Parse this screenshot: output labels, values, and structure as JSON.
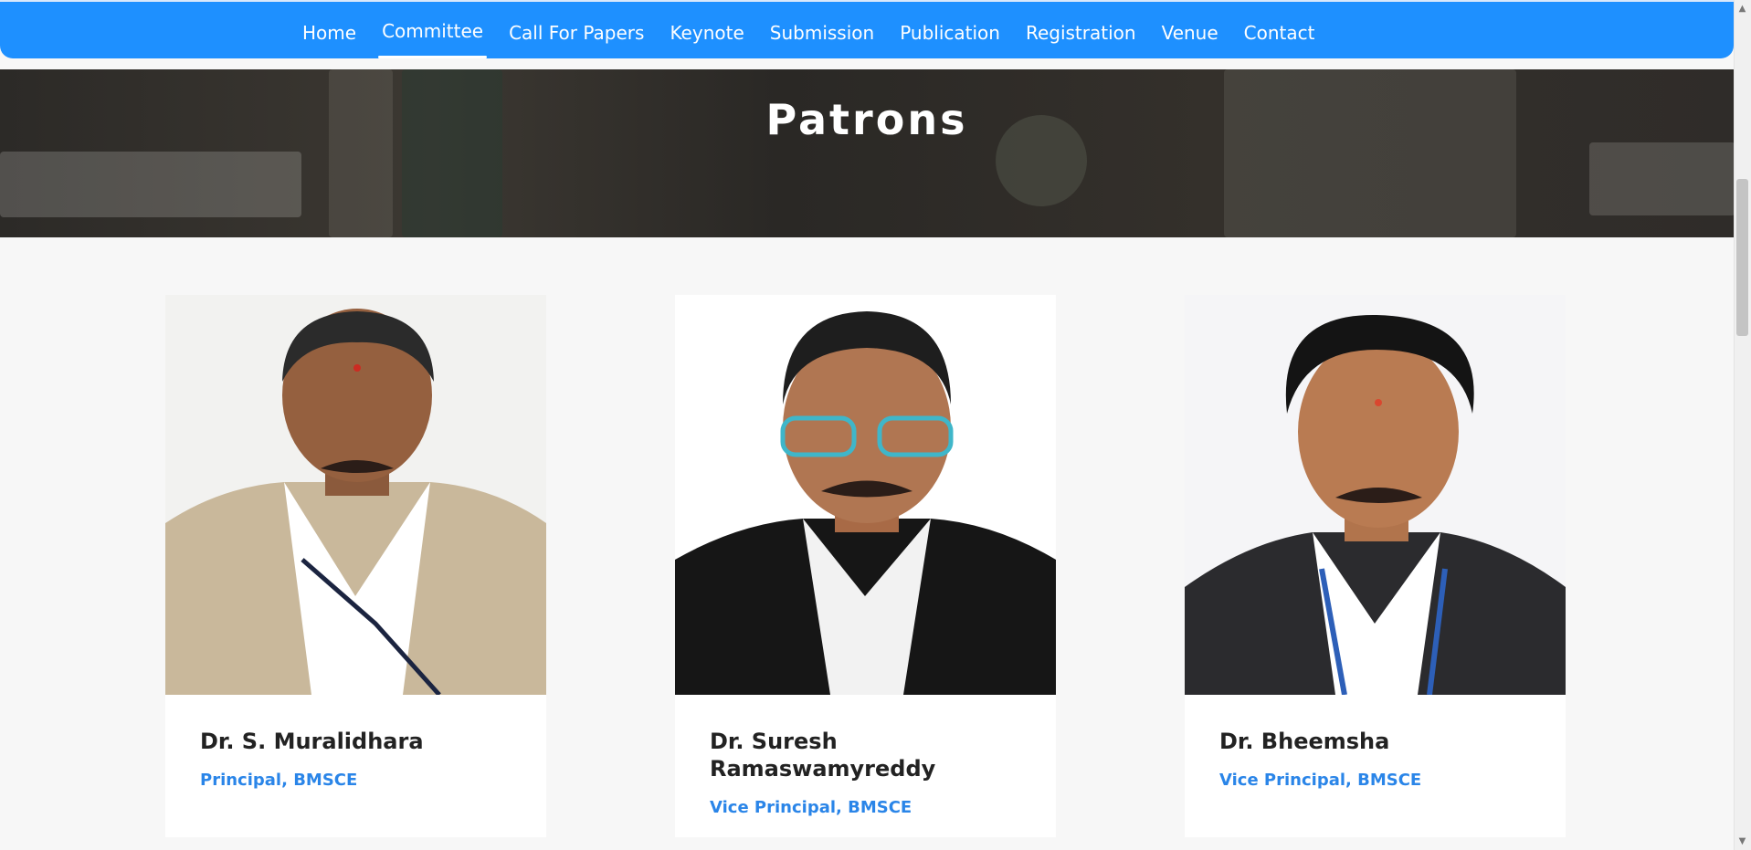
{
  "nav": {
    "items": [
      {
        "label": "Home"
      },
      {
        "label": "Committee"
      },
      {
        "label": "Call For Papers"
      },
      {
        "label": "Keynote"
      },
      {
        "label": "Submission"
      },
      {
        "label": "Publication"
      },
      {
        "label": "Registration"
      },
      {
        "label": "Venue"
      },
      {
        "label": "Contact"
      }
    ],
    "active": "Committee"
  },
  "banner": {
    "title": "Patrons"
  },
  "patrons": [
    {
      "name": "Dr. S. Muralidhara",
      "role": "Principal, BMSCE"
    },
    {
      "name": "Dr. Suresh Ramaswamyreddy",
      "role": "Vice Principal, BMSCE"
    },
    {
      "name": "Dr. Bheemsha",
      "role": "Vice Principal, BMSCE"
    }
  ],
  "colors": {
    "nav_bg": "#1e90ff",
    "role_text": "#2a85e8",
    "page_bg": "#f7f7f7"
  }
}
